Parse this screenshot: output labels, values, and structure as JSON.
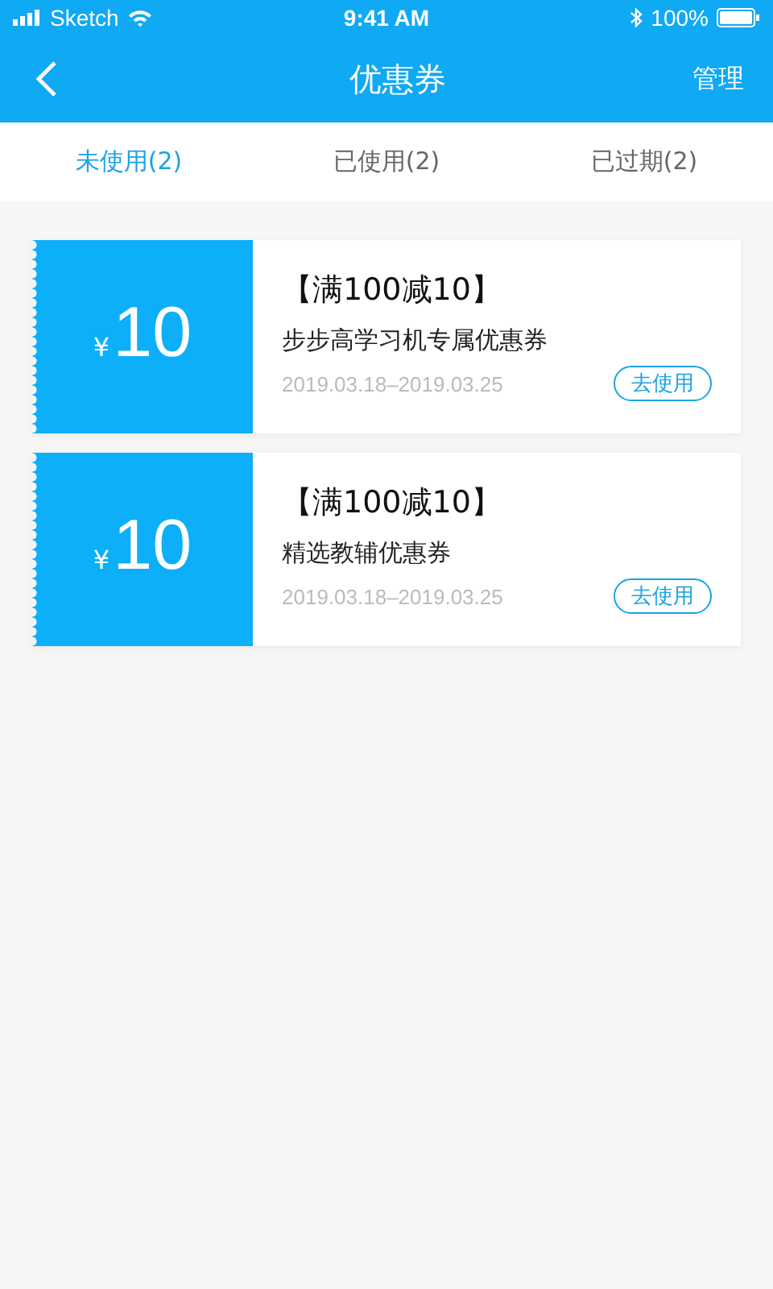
{
  "status_bar": {
    "carrier": "Sketch",
    "time": "9:41 AM",
    "battery": "100%"
  },
  "nav": {
    "title": "优惠券",
    "action": "管理"
  },
  "tabs": [
    {
      "label": "未使用(2)",
      "selected": true
    },
    {
      "label": "已使用(2)",
      "selected": false
    },
    {
      "label": "已过期(2)",
      "selected": false
    }
  ],
  "coupons": [
    {
      "currency": "¥",
      "amount": "10",
      "condition": "【满100减10】",
      "name": "步步高学习机专属优惠券",
      "period": "2019.03.18–2019.03.25",
      "action": "去使用"
    },
    {
      "currency": "¥",
      "amount": "10",
      "condition": "【满100减10】",
      "name": "精选教辅优惠券",
      "period": "2019.03.18–2019.03.25",
      "action": "去使用"
    }
  ]
}
